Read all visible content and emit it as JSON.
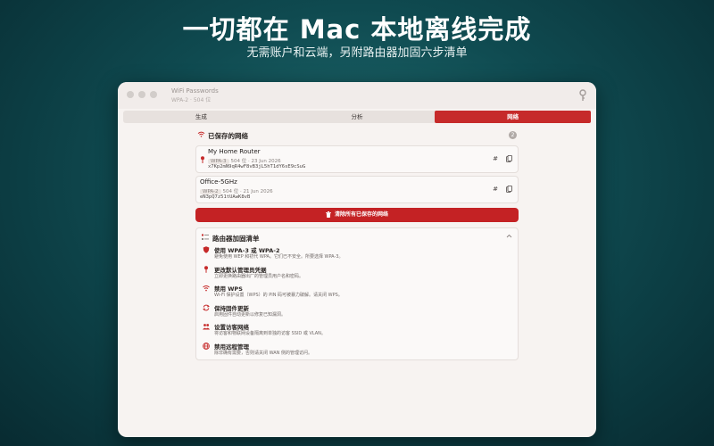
{
  "hero": {
    "title": "一切都在 Mac 本地离线完成",
    "subtitle": "无需账户和云端，另附路由器加固六步清单"
  },
  "window": {
    "title": "WiFi Passwords",
    "subtitle": "WPA-2 · 504 位"
  },
  "tabs": [
    {
      "label": "生成",
      "active": false
    },
    {
      "label": "分析",
      "active": false
    },
    {
      "label": "网络",
      "active": true
    }
  ],
  "saved": {
    "title": "已保存的网络",
    "count": "2",
    "networks": [
      {
        "name": "My Home Router",
        "type": "WPA-3",
        "info": "504 位 · 23 Jun 2026",
        "password": "x7Kp2mN9qR4wF8vB3jL5hT1dY6sE9cSuG",
        "pinned": true
      },
      {
        "name": "Office-5GHz",
        "type": "WPA-2",
        "info": "504 位 · 21 Jun 2026",
        "password": "eN3pQ7z51tUAwK8vB",
        "pinned": false
      }
    ],
    "hash_label": "#",
    "remove_all": "清除所有已保存的网络"
  },
  "checklist": {
    "title": "路由器加固清单",
    "items": [
      {
        "icon": "shield-icon",
        "title": "使用 WPA-3 或 WPA-2",
        "desc": "避免使用 WEP 和初代 WPA。它们已不安全。所要选择 WPA-3。"
      },
      {
        "icon": "key-icon",
        "title": "更改默认管理员凭据",
        "desc": "立即更换路由器出厂的管理员用户名和密码。"
      },
      {
        "icon": "wifi-off-icon",
        "title": "禁用 WPS",
        "desc": "Wi-Fi 保护设置（WPS）的 PIN 码可被暴力破解。请关闭 WPS。"
      },
      {
        "icon": "refresh-icon",
        "title": "保持固件更新",
        "desc": "启用固件自动更新以修复已知漏洞。"
      },
      {
        "icon": "people-icon",
        "title": "设置访客网络",
        "desc": "将访客和物联网设备隔离到单独的访客 SSID 或 VLAN。"
      },
      {
        "icon": "globe-icon",
        "title": "禁用远程管理",
        "desc": "除非确有需要，否则请关闭 WAN 侧的管理访问。"
      }
    ]
  },
  "colors": {
    "accent": "#c62a2a",
    "background": "#0f4a50",
    "window": "#f7f3f1"
  }
}
